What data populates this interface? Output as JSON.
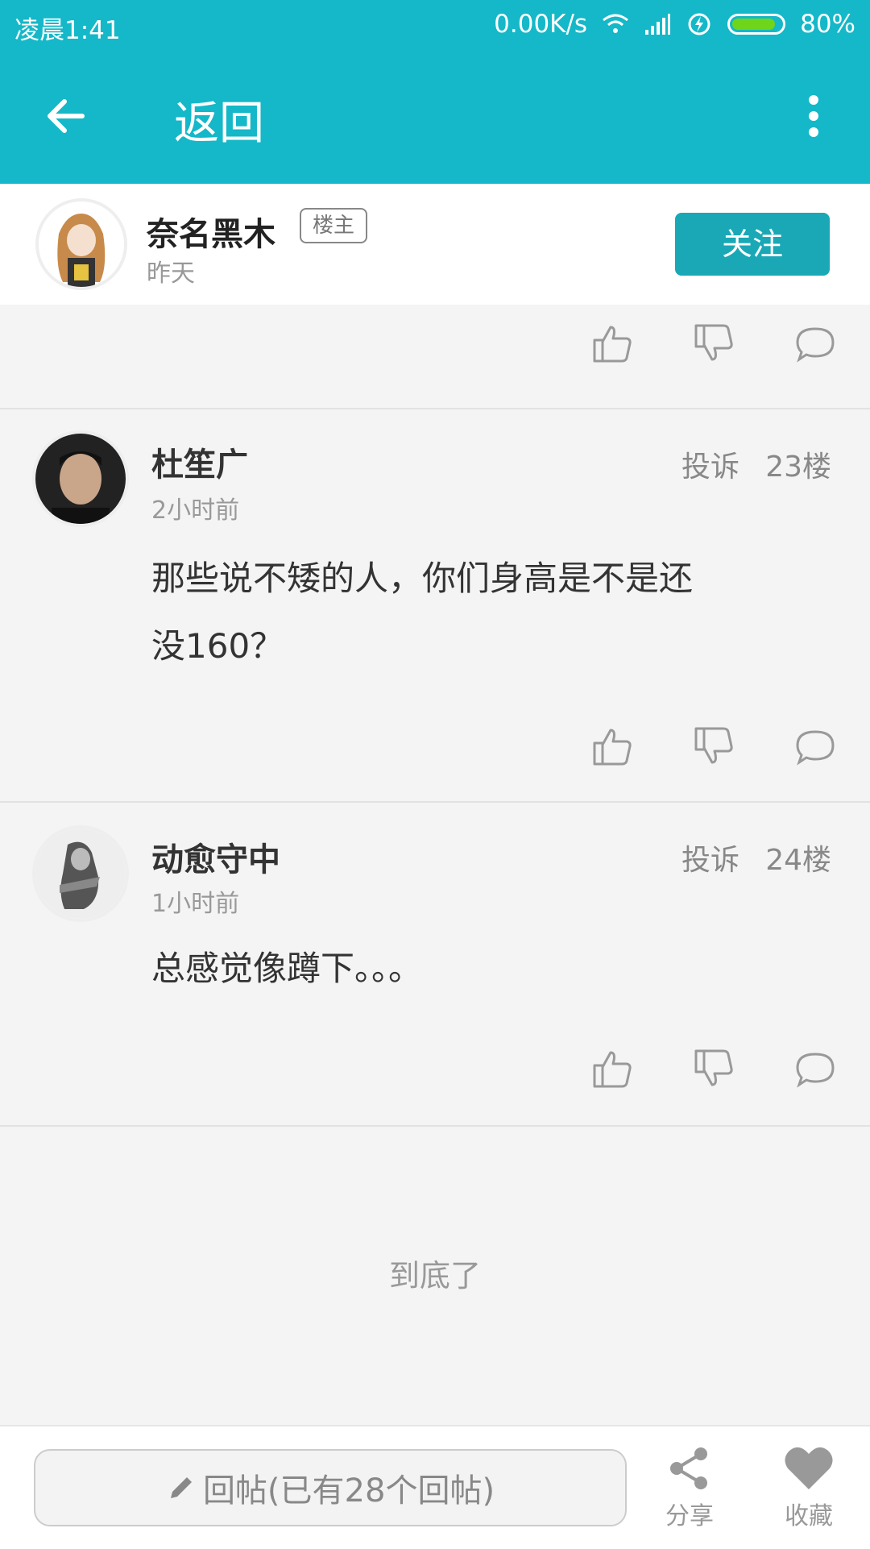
{
  "status": {
    "time": "凌晨1:41",
    "network_speed": "0.00K/s",
    "battery": "80%"
  },
  "appbar": {
    "title": "返回"
  },
  "op": {
    "name": "奈名黑木",
    "badge": "楼主",
    "time": "昨天",
    "follow_label": "关注"
  },
  "replies": [
    {
      "name": "杜笙广",
      "time": "2小时前",
      "report": "投诉",
      "floor": "23楼",
      "body": "那些说不矮的人，你们身高是不是还没160？"
    },
    {
      "name": "动愈守中",
      "time": "1小时前",
      "report": "投诉",
      "floor": "24楼",
      "body": "总感觉像蹲下。。。"
    }
  ],
  "end_text": "到底了",
  "bottombar": {
    "reply_placeholder": "回帖(已有28个回帖)",
    "share_label": "分享",
    "favorite_label": "收藏"
  },
  "colors": {
    "primary": "#14b8c8",
    "follow": "#1aa8b6",
    "battery": "#6ed51b"
  }
}
